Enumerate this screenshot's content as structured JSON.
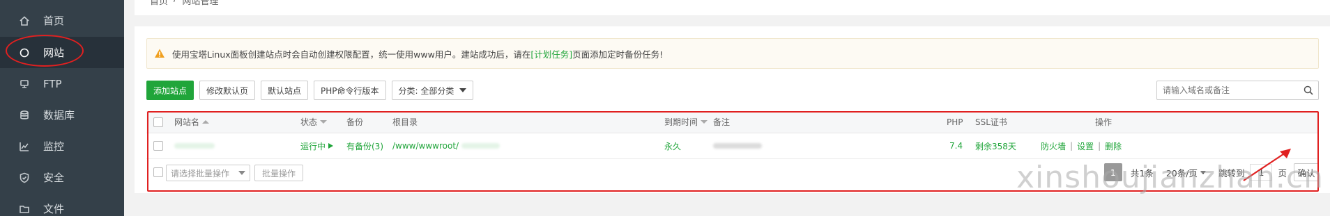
{
  "sidebar": {
    "items": [
      {
        "label": "首页",
        "icon": "home-icon"
      },
      {
        "label": "网站",
        "icon": "globe-icon",
        "active": true
      },
      {
        "label": "FTP",
        "icon": "ftp-icon"
      },
      {
        "label": "数据库",
        "icon": "database-icon"
      },
      {
        "label": "监控",
        "icon": "monitor-icon"
      },
      {
        "label": "安全",
        "icon": "shield-icon"
      },
      {
        "label": "文件",
        "icon": "folder-icon"
      }
    ]
  },
  "breadcrumb": {
    "home": "首页",
    "separator": "/",
    "current": "网站管理"
  },
  "notice": {
    "text_before": "使用宝塔Linux面板创建站点时会自动创建权限配置，统一使用www用户。建站成功后，请在",
    "link": "[计划任务]",
    "text_after": "页面添加定时备份任务!"
  },
  "toolbar": {
    "add_site": "添加站点",
    "edit_default_page": "修改默认页",
    "default_site": "默认站点",
    "php_cli_version": "PHP命令行版本",
    "category": "分类: 全部分类"
  },
  "search": {
    "placeholder": "请输入域名或备注"
  },
  "table": {
    "headers": {
      "site_name": "网站名",
      "status": "状态",
      "backup": "备份",
      "root_dir": "根目录",
      "expire": "到期时间",
      "remark": "备注",
      "php": "PHP",
      "ssl": "SSL证书",
      "ops": "操作"
    },
    "rows": [
      {
        "site_name": "",
        "status": "运行中",
        "status_icon": "play-icon",
        "backup": "有备份(3)",
        "root_dir": "/www/wwwroot/",
        "expire": "永久",
        "remark": "",
        "php": "7.4",
        "ssl": "剩余358天",
        "actions": [
          "防火墙",
          "设置",
          "删除"
        ]
      }
    ]
  },
  "footer": {
    "batch_select_placeholder": "请选择批量操作",
    "batch_button": "批量操作",
    "pagination": {
      "current": "1",
      "total": "共1条",
      "page_size": "20条/页",
      "jump_label": "跳转到",
      "jump_value": "1",
      "page_unit": "页",
      "confirm": "确认"
    }
  },
  "watermark": "xinshoujianzhan.cn",
  "colors": {
    "accent": "#20a53a",
    "sidebar": "#344049",
    "annotation": "#e02020"
  }
}
